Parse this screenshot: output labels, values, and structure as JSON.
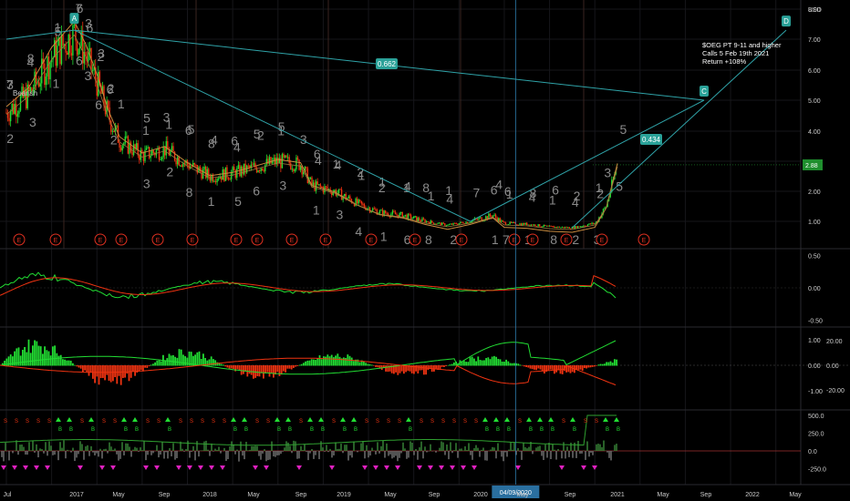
{
  "chart_data": [
    {
      "type": "candlestick",
      "currency": "USD",
      "price_scale_labels": [
        "8.00",
        "7.00",
        "6.00",
        "5.00",
        "4.00",
        "3.00",
        "2.00",
        "1.00"
      ],
      "last_price": "2.88",
      "time_labels": [
        "Jul",
        "2017",
        "May",
        "Sep",
        "2018",
        "May",
        "Sep",
        "2019",
        "May",
        "Sep",
        "2020",
        "May",
        "Sep",
        "2021",
        "May",
        "Sep",
        "2022",
        "May"
      ],
      "crosshair_date": "04/09/2020",
      "approx_close_series": [
        [
          "2016-07",
          4.6
        ],
        [
          "2016-09",
          5.2
        ],
        [
          "2016-11",
          6.4
        ],
        [
          "2017-01",
          7.2
        ],
        [
          "2017-02",
          6.5
        ],
        [
          "2017-03",
          5.6
        ],
        [
          "2017-04",
          4.5
        ],
        [
          "2017-05",
          3.7
        ],
        [
          "2017-07",
          3.2
        ],
        [
          "2017-09",
          3.4
        ],
        [
          "2017-11",
          2.9
        ],
        [
          "2018-01",
          2.5
        ],
        [
          "2018-03",
          2.6
        ],
        [
          "2018-05",
          2.8
        ],
        [
          "2018-07",
          3.0
        ],
        [
          "2018-09",
          2.9
        ],
        [
          "2018-10",
          2.2
        ],
        [
          "2018-12",
          2.0
        ],
        [
          "2019-02",
          1.6
        ],
        [
          "2019-04",
          1.3
        ],
        [
          "2019-06",
          1.2
        ],
        [
          "2019-08",
          1.0
        ],
        [
          "2019-10",
          0.8
        ],
        [
          "2019-12",
          1.0
        ],
        [
          "2020-02",
          1.2
        ],
        [
          "2020-03",
          0.9
        ],
        [
          "2020-05",
          0.85
        ],
        [
          "2020-07",
          0.7
        ],
        [
          "2020-09",
          0.65
        ],
        [
          "2020-11",
          0.9
        ],
        [
          "2020-12",
          1.5
        ],
        [
          "2021-01",
          2.88
        ]
      ],
      "drawing_labels": {
        "a": "A",
        "c": "C",
        "d": "D",
        "ratio_upper": "0.662",
        "ratio_lower": "0.434",
        "bearish": "Bearish"
      },
      "annotation": [
        "$OEG PT 9-11 and higher",
        "Calls 5 Feb 19th 2021",
        "Return +108%"
      ],
      "sequence_counts_top": [
        "3",
        "7",
        "8",
        "4",
        "1",
        "5",
        "7",
        "6",
        "3",
        "6",
        "2",
        "3",
        "6",
        "2",
        "1",
        "5",
        "1",
        "3",
        "1",
        "5",
        "6",
        "8",
        "4",
        "6",
        "4",
        "5",
        "2",
        "5",
        "1",
        "3",
        "4",
        "6",
        "1",
        "4",
        "1",
        "2",
        "1",
        "2",
        "1",
        "4",
        "1",
        "8",
        "4",
        "1",
        "7",
        "6",
        "4",
        "1",
        "6",
        "8",
        "4",
        "6",
        "1",
        "4",
        "2",
        "1",
        "2",
        "3",
        "5"
      ],
      "sequence_counts_bottom": [
        "2",
        "3",
        "1",
        "6",
        "3",
        "6",
        "2",
        "3",
        "2",
        "8",
        "1",
        "5",
        "6",
        "3",
        "1",
        "3",
        "4",
        "1",
        "6",
        "8",
        "2",
        "1",
        "7",
        "1",
        "8",
        "2",
        "3",
        "5"
      ],
      "earnings_marker": "E",
      "colors": {
        "bull": "#22dd33",
        "bear": "#ee3311",
        "fib_line": "#2fa3a8",
        "ma": "#c88a3e",
        "label_bg": "#2aa198"
      }
    },
    {
      "type": "line",
      "name": "oscillator_1",
      "ylim": [
        -0.5,
        0.5
      ],
      "tick_labels": [
        "0.50",
        "0.00",
        "-0.50"
      ]
    },
    {
      "type": "bar",
      "name": "oscillator_2",
      "ylim": [
        -1,
        1
      ],
      "tick_labels": [
        "1.00",
        "0.00",
        "-1.00"
      ],
      "right_tick_labels": [
        "20.00",
        "0.00",
        "-20.00"
      ]
    },
    {
      "type": "area",
      "name": "volume_oscillator",
      "ylim": [
        -250,
        500
      ],
      "tick_labels": [
        "500.0",
        "250.0",
        "0.0",
        "-250.0"
      ],
      "signal_labels": {
        "sell": "S",
        "buy": "B"
      }
    }
  ]
}
